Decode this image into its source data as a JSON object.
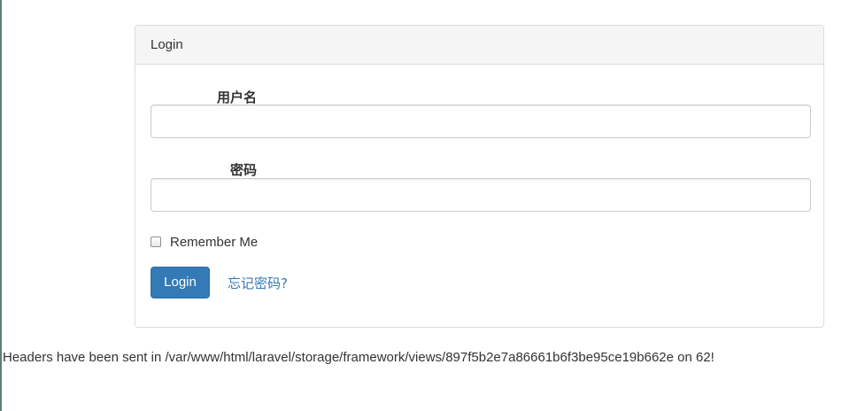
{
  "panel": {
    "heading": "Login"
  },
  "form": {
    "username_label": "用户名",
    "username_value": "",
    "password_label": "密码",
    "password_value": "",
    "remember_label": "Remember Me",
    "remember_checked": false,
    "login_button": "Login",
    "forgot_link": "忘记密码?"
  },
  "error": {
    "message": "Headers have been sent in /var/www/html/laravel/storage/framework/views/897f5b2e7a86661b6f3be95ce19b662e on 62!"
  },
  "colors": {
    "accent": "#337ab7",
    "panel_heading_bg": "#f5f5f5",
    "border": "#dddddd"
  }
}
